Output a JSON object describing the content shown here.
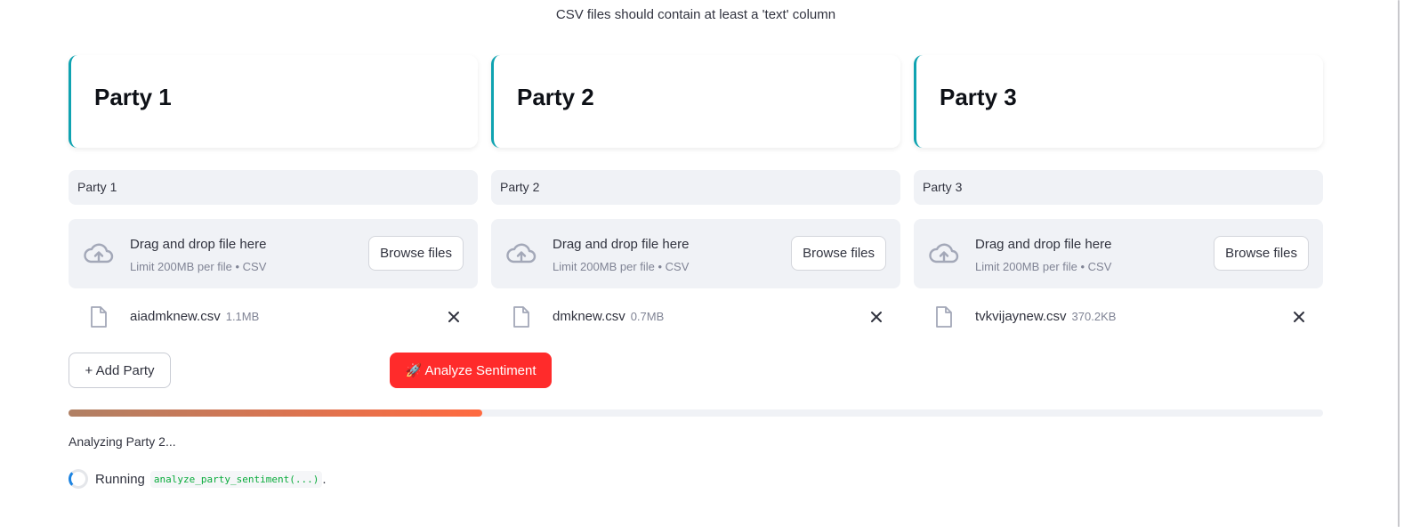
{
  "note": "CSV files should contain at least a 'text' column",
  "parties": [
    {
      "title": "Party 1",
      "name_value": "Party 1",
      "dropzone": {
        "main": "Drag and drop file here",
        "sub": "Limit 200MB per file • CSV",
        "button": "Browse files"
      },
      "file": {
        "name": "aiadmknew.csv",
        "size": "1.1MB"
      }
    },
    {
      "title": "Party 2",
      "name_value": "Party 2",
      "dropzone": {
        "main": "Drag and drop file here",
        "sub": "Limit 200MB per file • CSV",
        "button": "Browse files"
      },
      "file": {
        "name": "dmknew.csv",
        "size": "0.7MB"
      }
    },
    {
      "title": "Party 3",
      "name_value": "Party 3",
      "dropzone": {
        "main": "Drag and drop file here",
        "sub": "Limit 200MB per file • CSV",
        "button": "Browse files"
      },
      "file": {
        "name": "tvkvijaynew.csv",
        "size": "370.2KB"
      }
    }
  ],
  "actions": {
    "add_party": "+  Add Party",
    "analyze": "🚀 Analyze Sentiment"
  },
  "progress": {
    "fraction": 0.33
  },
  "status": "Analyzing Party 2...",
  "running": {
    "label": "Running",
    "code": "analyze_party_sentiment(...)",
    "suffix": "."
  },
  "icons": [
    "cloud-upload-icon",
    "file-icon",
    "close-icon",
    "rocket-icon",
    "spinner-icon"
  ],
  "colors": {
    "accent": "#0fa3b1",
    "primary_button": "#ff2b2b",
    "progress_start": "#b08064",
    "progress_end": "#ff6a40"
  }
}
